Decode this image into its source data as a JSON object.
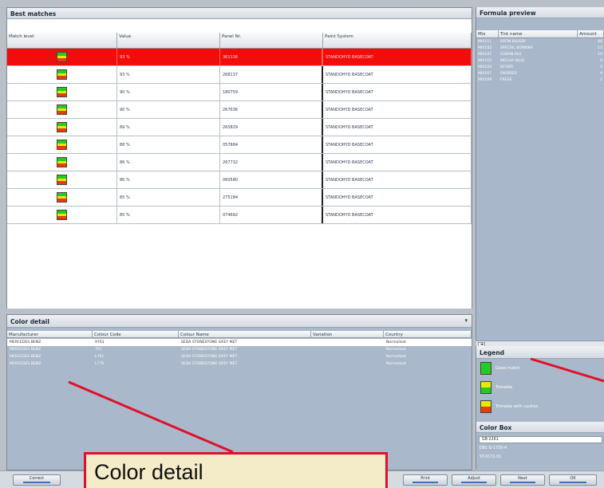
{
  "best_matches": {
    "title": "Best matches",
    "columns": [
      "Match level",
      "Value",
      "Panel Nr.",
      "Paint System"
    ],
    "rows": [
      {
        "value": "93 %",
        "panel": "361136",
        "system": "STANDOHYD BASECOAT",
        "selected": true
      },
      {
        "value": "93 %",
        "panel": "268137",
        "system": "STANDOHYD BASECOAT",
        "selected": false
      },
      {
        "value": "90 %",
        "panel": "180759",
        "system": "STANDOHYD BASECOAT",
        "selected": false
      },
      {
        "value": "90 %",
        "panel": "267636",
        "system": "STANDOHYD BASECOAT",
        "selected": false
      },
      {
        "value": "89 %",
        "panel": "265829",
        "system": "STANDOHYD BASECOAT",
        "selected": false
      },
      {
        "value": "88 %",
        "panel": "057684",
        "system": "STANDOHYD BASECOAT",
        "selected": false
      },
      {
        "value": "86 %",
        "panel": "267732",
        "system": "STANDOHYD BASECOAT",
        "selected": false
      },
      {
        "value": "86 %",
        "panel": "060580",
        "system": "STANDOHYD BASECOAT",
        "selected": false
      },
      {
        "value": "85 %",
        "panel": "275184",
        "system": "STANDOHYD BASECOAT",
        "selected": false
      },
      {
        "value": "85 %",
        "panel": "074692",
        "system": "STANDOHYD BASECOAT",
        "selected": false
      }
    ]
  },
  "formula_preview": {
    "title": "Formula preview",
    "columns": [
      "Mix",
      "Tint name",
      "Amount"
    ],
    "rows": [
      {
        "mix": "MIX111",
        "name": "SATIN BLUEBY",
        "amount": "48"
      },
      {
        "mix": "MIX102",
        "name": "SPECIAL BORNIKA",
        "amount": "13"
      },
      {
        "mix": "MIX107",
        "name": "CUBAN ALU",
        "amount": "10"
      },
      {
        "mix": "MIX112",
        "name": "MOCHA BLUE",
        "amount": "6"
      },
      {
        "mix": "MIX224",
        "name": "OCHER",
        "amount": "3"
      },
      {
        "mix": "MIX107",
        "name": "OXIDRED",
        "amount": "4"
      },
      {
        "mix": "MIX109",
        "name": "FRESS",
        "amount": "2"
      }
    ],
    "scroll_arrow": "◄"
  },
  "color_detail": {
    "title": "Color detail",
    "dropdown_icon": "▾",
    "columns": [
      "Manufacturer",
      "Colour Code",
      "Colour Name",
      "Variation",
      "Country"
    ],
    "rows": [
      {
        "manufacturer": "MERCEDES BENZ",
        "code": "9761",
        "name": "SEDA STONESTONE GREY MET",
        "variation": "",
        "country": "Normalisat"
      },
      {
        "manufacturer": "MERCEDES BENZ",
        "code": "761",
        "name": "SEDA STONESTONE GREY MET",
        "variation": "",
        "country": "Normalisat"
      },
      {
        "manufacturer": "MERCEDES BENZ",
        "code": "L761",
        "name": "SEDA STONESTONE GREY MET",
        "variation": "",
        "country": "Normalisat"
      },
      {
        "manufacturer": "MERCEDES BENZ",
        "code": "L776",
        "name": "SEDA STONESTONE GREY MET",
        "variation": "",
        "country": "Normalisat"
      }
    ]
  },
  "legend": {
    "title": "Legend",
    "items": [
      {
        "label": "Good match",
        "colors": [
          "#22cc22",
          "#22cc22"
        ]
      },
      {
        "label": "Trimable",
        "colors": [
          "#e8e800",
          "#22cc22"
        ]
      },
      {
        "label": "Trimable with caution",
        "colors": [
          "#e8e800",
          "#e04010"
        ]
      }
    ]
  },
  "color_box": {
    "title": "Color Box",
    "field_value": "GB 2261",
    "lines": [
      "DB1 G-1735-4",
      "ST-9172-01"
    ]
  },
  "buttons": {
    "correct": "Correct",
    "print": "Print",
    "adjust": "Adjust",
    "next": "Next",
    "ok": "OK"
  },
  "callout": {
    "text": "Color detail"
  },
  "colors": {
    "selected_row": "#f20d0d",
    "match_green": "#22cc22",
    "match_yellow": "#e8e800",
    "match_red": "#e04010",
    "callout_border": "#e0102a"
  }
}
